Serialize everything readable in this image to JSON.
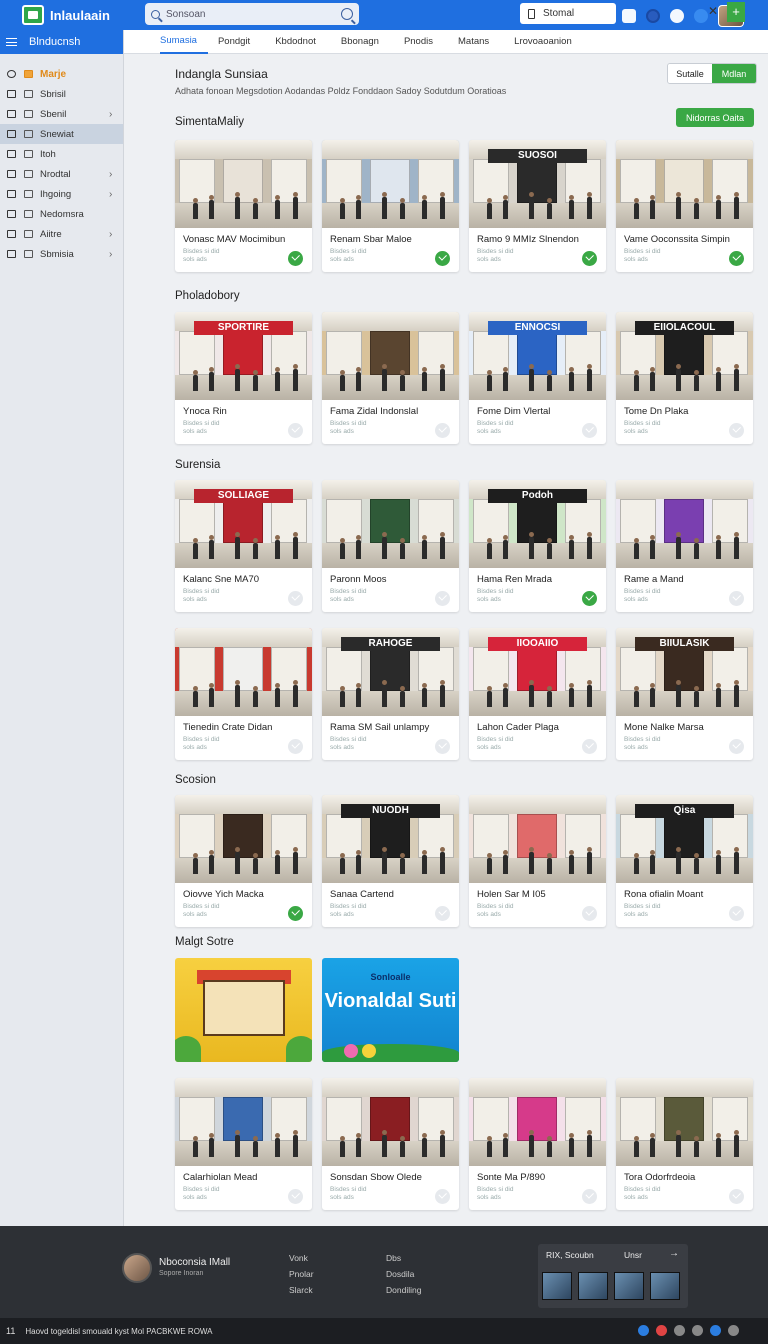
{
  "app": {
    "name": "Inlaulaain"
  },
  "search": {
    "placeholder": "Sonsoan"
  },
  "top_select": {
    "label": "Stomal"
  },
  "sidebar": {
    "header": "Blnducnsh",
    "items": [
      {
        "label": "Marje",
        "icon": "home-icon",
        "chevron": ""
      },
      {
        "label": "Sbrisil",
        "icon": "grid-icon",
        "chevron": ""
      },
      {
        "label": "Sbenil",
        "icon": "list-icon",
        "chevron": "›"
      },
      {
        "label": "Snewiat",
        "icon": "user-icon",
        "chevron": ""
      },
      {
        "label": "Itoh",
        "icon": "square-icon",
        "chevron": ""
      },
      {
        "label": "Nrodtal",
        "icon": "people-icon",
        "chevron": "›"
      },
      {
        "label": "Ihgoing",
        "icon": "tag-icon",
        "chevron": "›"
      },
      {
        "label": "Nedomsra",
        "icon": "link-icon",
        "chevron": ""
      },
      {
        "label": "Aiitre",
        "icon": "flag-icon",
        "chevron": "›"
      },
      {
        "label": "Sbmisia",
        "icon": "doc-icon",
        "chevron": "›"
      }
    ]
  },
  "tabs": [
    "Sumasia",
    "Pondgit",
    "Kbdodnot",
    "Bbonagn",
    "Pnodis",
    "Matans",
    "Lrovoaoanion"
  ],
  "page": {
    "title": "Indangla Sunsiaa",
    "btn_secondary": "Sutalle",
    "btn_primary": "Mdlan",
    "filters": "Adhata fonoan   Megsdotion   Aodandas   Poldz   Fonddaon   Sadoy   Sodutdum   Ooratioas",
    "action_button": "Nidorras Oaita"
  },
  "sections": [
    {
      "title": "SimentaMaliy",
      "cards": [
        {
          "title": "Vonasc MAV Mocimibun",
          "meta": "Bisdes si did\nsols ads",
          "checked": true,
          "sign": "",
          "colors": [
            "#e8e2d8",
            "#c9c0b0"
          ]
        },
        {
          "title": "Renam Sbar Maloe",
          "meta": "Bisdes si did\nsols ads",
          "checked": true,
          "sign": "",
          "colors": [
            "#dfe6ee",
            "#9fb4c8"
          ]
        },
        {
          "title": "Ramo 9 MMIz Slnendon",
          "meta": "Bisdes si did\nsols ads",
          "checked": true,
          "sign": "SUOSOI",
          "colors": [
            "#2a2a2a",
            "#d8d4cc"
          ]
        },
        {
          "title": "Vame Ooconssita Simpin",
          "meta": "Bisdes si did\nsols ads",
          "checked": true,
          "sign": "",
          "colors": [
            "#ece6d8",
            "#c8b89a"
          ]
        }
      ]
    },
    {
      "title": "Pholadobory",
      "cards": [
        {
          "title": "Ynoca Rin",
          "meta": "Bisdes si did\nsols ads",
          "checked": false,
          "sign": "SPORTIRE",
          "colors": [
            "#c9232e",
            "#f0e8e8"
          ]
        },
        {
          "title": "Fama Zidal Indonslal",
          "meta": "Bisdes si did\nsols ads",
          "checked": false,
          "sign": "",
          "colors": [
            "#5a4530",
            "#d9c29a"
          ]
        },
        {
          "title": "Fome Dim Vlertal",
          "meta": "Bisdes si did\nsols ads",
          "checked": false,
          "sign": "ENNOCSI",
          "colors": [
            "#2b64c4",
            "#e6eef8"
          ]
        },
        {
          "title": "Tome Dn Plaka",
          "meta": "Bisdes si did\nsols ads",
          "checked": false,
          "sign": "EIIOLACOUL",
          "colors": [
            "#1e1e1e",
            "#d8c9b0"
          ]
        }
      ]
    },
    {
      "title": "Surensia",
      "cards": [
        {
          "title": "Kalanc Sne MA70",
          "meta": "Bisdes si did\nsols ads",
          "checked": false,
          "sign": "SOLLIAGE",
          "colors": [
            "#b8242e",
            "#eee"
          ]
        },
        {
          "title": "Paronn Moos",
          "meta": "Bisdes si did\nsols ads",
          "checked": false,
          "sign": "",
          "colors": [
            "#2f5a38",
            "#d8dcd4"
          ]
        },
        {
          "title": "Hama Ren Mrada",
          "meta": "Bisdes si did\nsols ads",
          "checked": true,
          "sign": "Podoh",
          "colors": [
            "#1e1e1e",
            "#cfe6c8"
          ]
        },
        {
          "title": "Rame a Mand",
          "meta": "Bisdes si did\nsols ads",
          "checked": false,
          "sign": "",
          "colors": [
            "#7a3fb0",
            "#ece8f2"
          ]
        },
        {
          "title": "Tienedin Crate Didan",
          "meta": "Bisdes si did\nsols ads",
          "checked": false,
          "sign": "",
          "colors": [
            "#f0f0ee",
            "#c83a30"
          ]
        },
        {
          "title": "Rama SM Sail unlampy",
          "meta": "Bisdes si did\nsols ads",
          "checked": false,
          "sign": "RAHOGE",
          "colors": [
            "#2a2a2a",
            "#e0dcd4"
          ]
        },
        {
          "title": "Lahon Cader Plaga",
          "meta": "Bisdes si did\nsols ads",
          "checked": false,
          "sign": "IIOOAIIO",
          "colors": [
            "#d6243a",
            "#f4e6ee"
          ]
        },
        {
          "title": "Mone Nalke Marsa",
          "meta": "Bisdes si did\nsols ads",
          "checked": false,
          "sign": "BIIULASIK",
          "colors": [
            "#3a2a20",
            "#e4d8c8"
          ]
        }
      ]
    },
    {
      "title": "Scosion",
      "cards": [
        {
          "title": "Oiovve Yich Macka",
          "meta": "Bisdes si did\nsols ads",
          "checked": true,
          "sign": "",
          "colors": [
            "#3a2a20",
            "#ded2c0"
          ]
        },
        {
          "title": "Sanaa Cartend",
          "meta": "Bisdes si did\nsols ads",
          "checked": false,
          "sign": "NUODH",
          "colors": [
            "#1e1e1e",
            "#d8cdb8"
          ]
        },
        {
          "title": "Holen Sar M I05",
          "meta": "Bisdes si did\nsols ads",
          "checked": false,
          "sign": "",
          "colors": [
            "#e06a6a",
            "#f0e2dc"
          ]
        },
        {
          "title": "Rona ofialin Moant",
          "meta": "Bisdes si did\nsols ads",
          "checked": false,
          "sign": "Qisa",
          "colors": [
            "#1e1e1e",
            "#c8d8e0"
          ]
        }
      ]
    },
    {
      "title": "Malgt Sotre",
      "promos": [
        {
          "type": "illustration",
          "label": ""
        },
        {
          "type": "banner",
          "small": "Sonloalle",
          "big": "Vionaldal Suti"
        }
      ],
      "cards": [
        {
          "title": "Calarhiolan Mead",
          "meta": "Bisdes si did\nsols ads",
          "checked": false,
          "sign": "",
          "colors": [
            "#3a6ab0",
            "#d0d6dc"
          ]
        },
        {
          "title": "Sonsdan Sbow Olede",
          "meta": "Bisdes si did\nsols ads",
          "checked": false,
          "sign": "",
          "colors": [
            "#8a1e22",
            "#e0d6d0"
          ]
        },
        {
          "title": "Sonte Ma P/890",
          "meta": "Bisdes si did\nsols ads",
          "checked": false,
          "sign": "",
          "colors": [
            "#d63a8a",
            "#f4e0ea"
          ]
        },
        {
          "title": "Tora Odorfrdeoia",
          "meta": "Bisdes si did\nsols ads",
          "checked": false,
          "sign": "",
          "colors": [
            "#5a5a3a",
            "#e2ddd0"
          ]
        }
      ]
    }
  ],
  "footer": {
    "user_name": "Nboconsia IMall",
    "user_sub": "Sopore Inoran",
    "col1": [
      "Vonk",
      "Pnolar",
      "Slarck"
    ],
    "col2": [
      "Dbs",
      "Dosdila",
      "Dondiling"
    ],
    "box_left": "RIX, Scoubn",
    "box_right": "Unsr",
    "box_arrow": "→"
  },
  "statusbar": {
    "number": "11",
    "text": "Haovd togeldisl smouald kyst Mol PACBKWE ROWA"
  }
}
